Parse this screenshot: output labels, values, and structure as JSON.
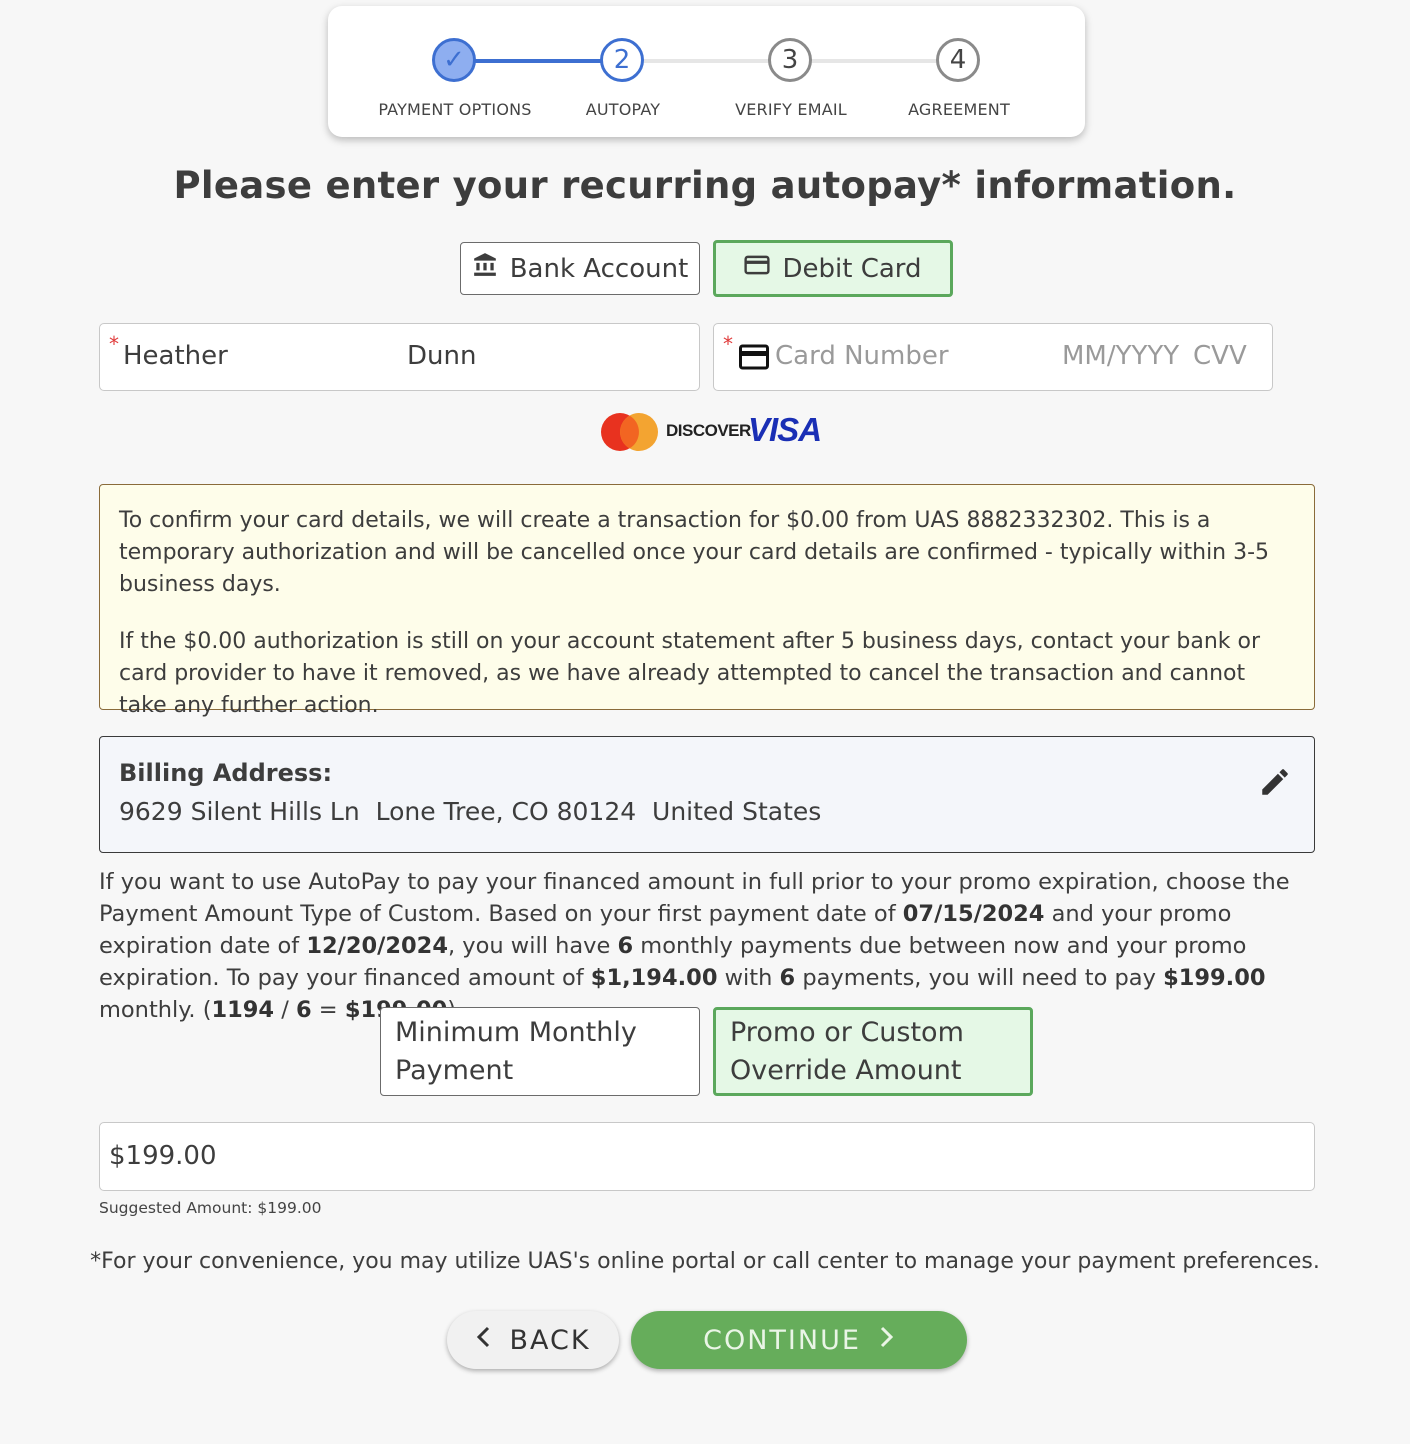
{
  "stepper": {
    "steps": [
      {
        "number": "✓",
        "label": "PAYMENT OPTIONS",
        "state": "complete"
      },
      {
        "number": "2",
        "label": "AUTOPAY",
        "state": "current"
      },
      {
        "number": "3",
        "label": "VERIFY EMAIL",
        "state": "upcoming"
      },
      {
        "number": "4",
        "label": "AGREEMENT",
        "state": "upcoming"
      }
    ]
  },
  "page_title": "Please enter your recurring autopay* information.",
  "method_toggle": {
    "bank_label": "Bank Account",
    "bank_icon": "bank-icon",
    "card_label": "Debit Card",
    "card_icon": "credit-card-icon",
    "selected": "Debit Card"
  },
  "name_field": {
    "required_mark": "*",
    "first_name": "Heather",
    "last_name": "Dunn"
  },
  "card_field": {
    "required_mark": "*",
    "number_placeholder": "Card Number",
    "expiry_placeholder": "MM/YYYY",
    "cvv_placeholder": "CVV"
  },
  "card_brands": {
    "discover": "DISCOVER",
    "visa": "VISA"
  },
  "notice": {
    "paragraph1": "To confirm your card details, we will create a transaction for $0.00 from UAS 8882332302. This is a temporary authorization and will be cancelled once your card details are confirmed - typically within 3-5 business days.",
    "paragraph2": "If the $0.00 authorization is still on your account statement after 5 business days, contact your bank or card provider to have it removed, as we have already attempted to cancel the transaction and cannot take any further action."
  },
  "billing": {
    "heading": "Billing Address:",
    "address": "9629 Silent Hills Ln  Lone Tree, CO 80124  United States"
  },
  "info": {
    "t1": "If you want to use AutoPay to pay your financed amount in full prior to your promo expiration, choose the Payment Amount Type of Custom. Based on your first payment date of ",
    "first_payment_date": "07/15/2024",
    "t2": " and your promo expiration date of ",
    "promo_expiration": "12/20/2024",
    "t3": ", you will have ",
    "payments_count": "6",
    "t4": " monthly payments due between now and your promo expiration. To pay your financed amount of ",
    "financed_amount": "$1,194.00",
    "t5": " with ",
    "payments_count2": "6",
    "t6": " payments, you will need to pay ",
    "monthly_amount": "$199.00",
    "t7": " monthly. (",
    "calc_total": "1194",
    "t8": " / ",
    "calc_count": "6",
    "t9": " = ",
    "calc_result": "$199.00",
    "t10": ")."
  },
  "amount_type": {
    "minimum_label": "Minimum Monthly Payment",
    "custom_label": "Promo or Custom Override Amount",
    "selected": "Promo or Custom Override Amount"
  },
  "amount_field": {
    "value": "$199.00",
    "suggested": "Suggested Amount: $199.00"
  },
  "footnote": "*For your convenience, you may utilize UAS's online portal or call center to manage your payment preferences.",
  "buttons": {
    "back": "BACK",
    "continue": "CONTINUE"
  },
  "colors": {
    "step_blue": "#3d6fd1",
    "step_complete_fill": "#8eaef0",
    "selected_green_border": "#5ba85c",
    "selected_green_bg": "#e5f8e6",
    "continue_green": "#66ad5b",
    "notice_bg": "#fefdea",
    "required_red": "#e03b3b",
    "visa_blue": "#1a2fb5",
    "mastercard_red": "#e8321f",
    "mastercard_orange": "#f29c1f"
  }
}
